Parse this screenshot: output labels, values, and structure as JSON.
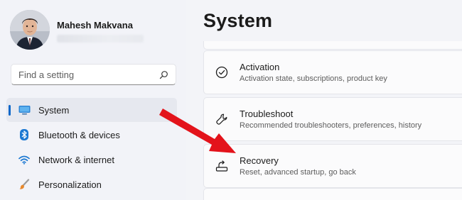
{
  "window": {
    "page_title": "System"
  },
  "profile": {
    "name": "Mahesh Makvana"
  },
  "search": {
    "placeholder": "Find a setting",
    "icon": "search-icon"
  },
  "sidebar": {
    "items": [
      {
        "label": "System",
        "icon": "system-monitor-icon",
        "active": true
      },
      {
        "label": "Bluetooth & devices",
        "icon": "bluetooth-icon",
        "active": false
      },
      {
        "label": "Network & internet",
        "icon": "wifi-icon",
        "active": false
      },
      {
        "label": "Personalization",
        "icon": "brush-icon",
        "active": false
      }
    ]
  },
  "settings": [
    {
      "title": "Activation",
      "subtitle": "Activation state, subscriptions, product key",
      "icon": "check-circle-icon"
    },
    {
      "title": "Troubleshoot",
      "subtitle": "Recommended troubleshooters, preferences, history",
      "icon": "wrench-icon"
    },
    {
      "title": "Recovery",
      "subtitle": "Reset, advanced startup, go back",
      "icon": "recovery-icon"
    }
  ],
  "colors": {
    "accent": "#0a67c9",
    "arrow": "#e3131b",
    "background": "#f3f4f8",
    "card": "#fbfbfc"
  }
}
